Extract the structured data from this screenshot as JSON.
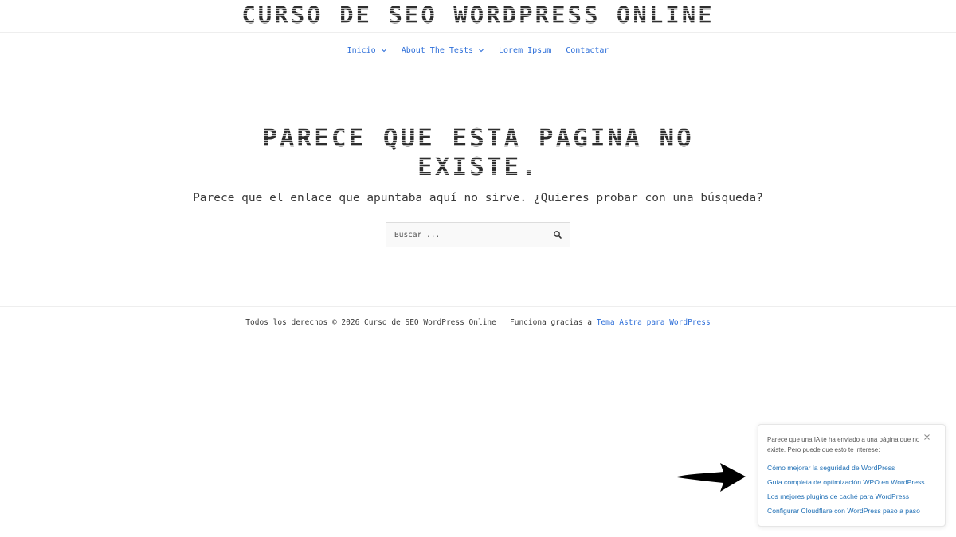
{
  "site": {
    "title": "CURSO DE SEO WORDPRESS ONLINE"
  },
  "nav": {
    "items": [
      {
        "label": "Inicio",
        "has_submenu": true
      },
      {
        "label": "About The Tests",
        "has_submenu": true
      },
      {
        "label": "Lorem Ipsum",
        "has_submenu": false
      },
      {
        "label": "Contactar",
        "has_submenu": false
      }
    ]
  },
  "error": {
    "title": "PARECE QUE ESTA PAGINA NO EXISTE.",
    "text": "Parece que el enlace que apuntaba aquí no sirve. ¿Quieres probar con una búsqueda?"
  },
  "search": {
    "placeholder": "Buscar ...",
    "icon": "search-icon"
  },
  "footer": {
    "text": "Todos los derechos © 2026 Curso de SEO WordPress Online | Funciona gracias a ",
    "link": "Tema Astra para WordPress"
  },
  "ai_widget": {
    "message": "Parece que una IA te ha enviado a una página que no existe. Pero puede que esto te interese:",
    "links": [
      "Cómo mejorar la seguridad de WordPress",
      "Guía completa de optimización WPO en WordPress",
      "Los mejores plugins de caché para WordPress",
      "Configurar Cloudflare con WordPress paso a paso"
    ],
    "close_icon": "close-icon"
  },
  "colors": {
    "link": "#2e6fd9",
    "widget_link": "#1f6fb5",
    "text": "#3a3a3a"
  }
}
